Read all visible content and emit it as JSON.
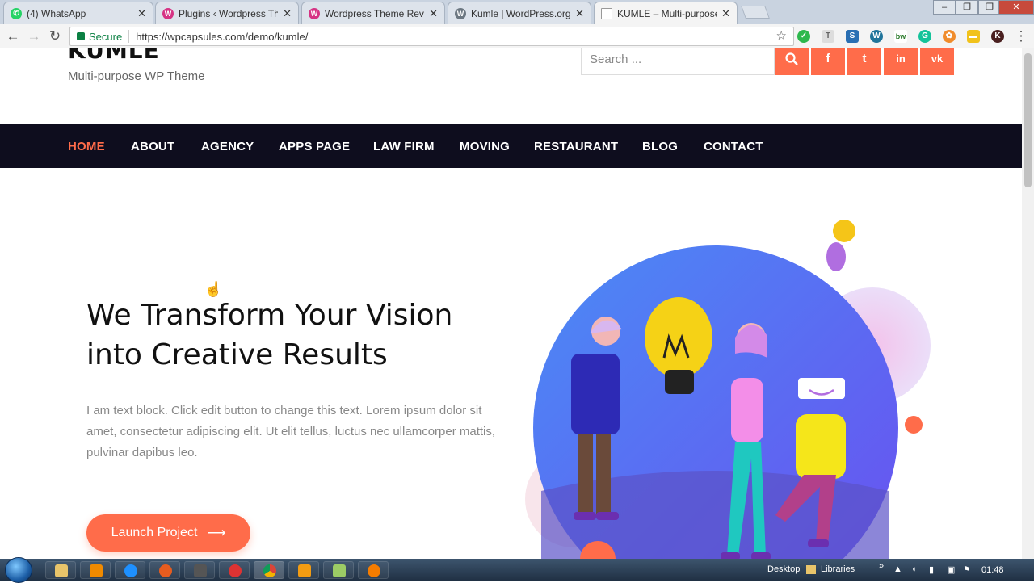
{
  "browser": {
    "tabs": [
      {
        "title": "(4) WhatsApp",
        "icon": "whatsapp-icon",
        "color": "#25d366"
      },
      {
        "title": "Plugins ‹ Wordpress Then",
        "icon": "admin-icon",
        "color": "#d63384"
      },
      {
        "title": "Wordpress Theme Reviews",
        "icon": "admin-icon",
        "color": "#d63384"
      },
      {
        "title": "Kumle | WordPress.org",
        "icon": "wordpress-icon",
        "color": "#6c7781"
      },
      {
        "title": "KUMLE – Multi-purpose W",
        "icon": "page-icon",
        "color": "#ffffff"
      }
    ],
    "window_controls": {
      "minimize": "–",
      "restore": "❐",
      "close": "✕"
    },
    "secure_label": "Secure",
    "url": "https://wpcapsules.com/demo/kumle/"
  },
  "site": {
    "brand": "KUMLE",
    "tagline": "Multi-purpose WP Theme",
    "search_placeholder": "Search ...",
    "social": [
      "f",
      "t",
      "in",
      "vk"
    ],
    "nav": [
      "HOME",
      "ABOUT",
      "AGENCY",
      "APPS PAGE",
      "LAW FIRM",
      "MOVING",
      "RESTAURANT",
      "BLOG",
      "CONTACT"
    ],
    "headline_line1": "We Transform Your Vision",
    "headline_line2": "into Creative Results",
    "body_text": "I am text block. Click edit button to change this text. Lorem ipsum dolor sit amet, consectetur adipiscing elit. Ut elit tellus, luctus nec ullamcorper mattis, pulvinar dapibus leo.",
    "cta_label": "Launch Project",
    "accent": "#ff6c4a",
    "nav_bg": "#0e0d1e"
  },
  "taskbar": {
    "desktop_label": "Desktop",
    "libraries_label": "Libraries",
    "time": "01:48"
  }
}
